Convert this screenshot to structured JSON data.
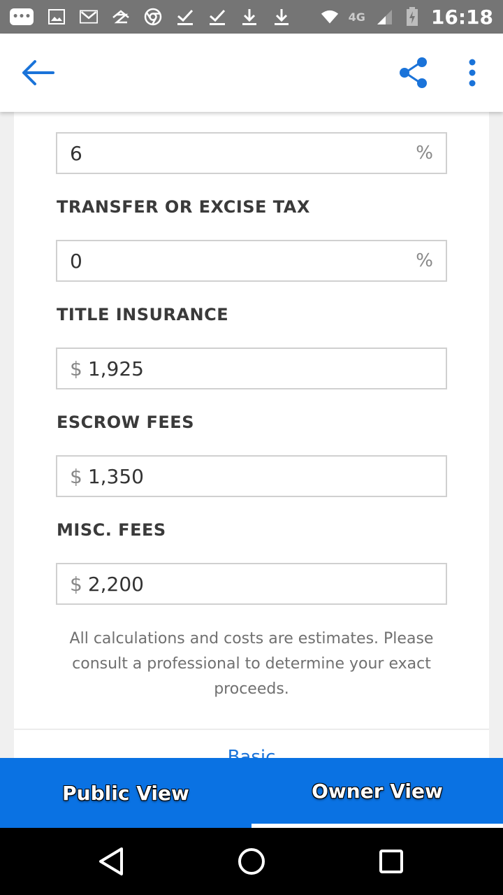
{
  "status_bar": {
    "time": "16:18",
    "network": "4G",
    "icons": [
      "chat-bubble-icon",
      "image-icon",
      "gmail-icon",
      "zillow-icon",
      "chrome-icon",
      "check-icon",
      "check-icon",
      "download-icon",
      "download-icon",
      "wifi-icon",
      "signal-icon",
      "battery-charging-icon"
    ],
    "bubble_text": "•••"
  },
  "app_bar": {
    "back_icon": "arrow-back-icon",
    "share_icon": "share-icon",
    "more_icon": "more-vert-icon",
    "accent": "#1a73d9"
  },
  "form": {
    "commission": {
      "value": "6",
      "suffix": "%"
    },
    "transfer_tax": {
      "label": "TRANSFER OR EXCISE TAX",
      "value": "0",
      "suffix": "%"
    },
    "title_insurance": {
      "label": "TITLE INSURANCE",
      "prefix": "$",
      "value": "1,925"
    },
    "escrow_fees": {
      "label": "ESCROW FEES",
      "prefix": "$",
      "value": "1,350"
    },
    "misc_fees": {
      "label": "MISC. FEES",
      "prefix": "$",
      "value": "2,200"
    }
  },
  "disclaimer": "All calculations and costs are estimates. Please consult a professional to determine your exact proceeds.",
  "basic_link": "Basic",
  "tabs": [
    {
      "label": "Public View",
      "active": false
    },
    {
      "label": "Owner View",
      "active": true
    }
  ],
  "tab_bar_color": "#0a72e3",
  "nav_bar": {
    "icons": [
      "back-triangle-icon",
      "home-circle-icon",
      "recents-square-icon"
    ]
  }
}
